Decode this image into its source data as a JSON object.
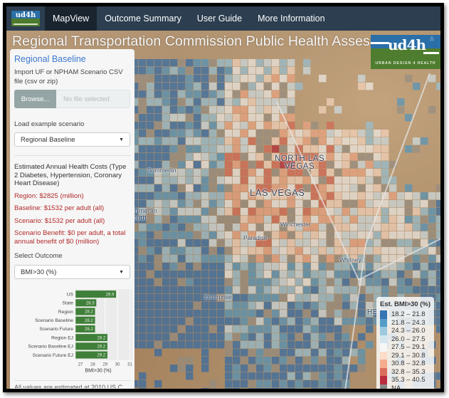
{
  "navbar": {
    "brand_logo": "ud4h",
    "items": [
      {
        "label": "MapView",
        "active": true
      },
      {
        "label": "Outcome Summary",
        "active": false
      },
      {
        "label": "User Guide",
        "active": false
      },
      {
        "label": "More Information",
        "active": false
      }
    ]
  },
  "map": {
    "title": "Regional Transportation Commission Public Health Assessment M",
    "logo": {
      "mark": "ud4h",
      "tagline": "URBAN DESIGN 4 HEALTH"
    },
    "collapse_icon": "chevron-double-down-icon",
    "places": [
      {
        "label": "NORTH LAS",
        "label2": "VEGAS"
      },
      {
        "label": "LAS VEGAS"
      },
      {
        "label": "Summerlin"
      },
      {
        "label": "mmerlin",
        "label2": "outh"
      },
      {
        "label": "Winchester"
      },
      {
        "label": "Paradise"
      },
      {
        "label": "Whitney"
      },
      {
        "label": "Enterprise"
      },
      {
        "label": "HEN"
      }
    ],
    "legend": {
      "title": "Est. BMI>30 (%)",
      "items": [
        {
          "label": "18.2 – 21.8",
          "color": "#2166ac"
        },
        {
          "label": "21.8 – 24.3",
          "color": "#4393c3"
        },
        {
          "label": "24.3 – 26.0",
          "color": "#92c5de"
        },
        {
          "label": "26.0 – 27.5",
          "color": "#d1e5f0"
        },
        {
          "label": "27.5 – 29.1",
          "color": "#f7f7f7"
        },
        {
          "label": "29.1 – 30.8",
          "color": "#fddbc7"
        },
        {
          "label": "30.8 – 32.8",
          "color": "#f4a582"
        },
        {
          "label": "32.8 – 35.3",
          "color": "#d6604d"
        },
        {
          "label": "35.3 – 40.5",
          "color": "#b2182b"
        },
        {
          "label": "NA",
          "color": "#808080"
        }
      ]
    }
  },
  "sidebar": {
    "title": "Regional Baseline",
    "import_label": "Import UF or NPHAM Scenario CSV file (csv or zip)",
    "browse_label": "Browse...",
    "file_placeholder": "No file selected",
    "example_label": "Load example scenario",
    "example_value": "Regional Baseline",
    "costs_title": "Estimated Annual Health Costs (Type 2 Diabetes, Hypertension, Coronary Heart Disease)",
    "region_cost": "Region: $2825 (million)",
    "baseline_cost": "Baseline: $1532 per adult (all)",
    "scenario_cost": "Scenario: $1532 per adult (all)",
    "scenario_benefit": "Scenario Benefit: $0 per adult, a total annual benefit of $0 (million)",
    "outcome_label": "Select Outcome",
    "outcome_value": "BMI>30 (%)",
    "footer_partial": "All values are estimated at 2010 US C..."
  },
  "chart_data": {
    "type": "bar",
    "orientation": "horizontal",
    "categories": [
      "US",
      "State",
      "Region",
      "Scenario Baseline",
      "Scenario Future",
      "Region EJ",
      "Scenario Baseline EJ",
      "Scenario Future EJ"
    ],
    "values": [
      29.9,
      28.3,
      28.2,
      28.2,
      28.2,
      29.2,
      29.2,
      29.2
    ],
    "data_labels": [
      "29.9",
      "28.3",
      "28.2",
      "28.2",
      "28.2",
      "29.2",
      "29.2",
      "29.2"
    ],
    "xlabel": "BMI>30 (%)",
    "ylabel": "",
    "xlim": [
      26.6,
      31.2
    ],
    "xticks": [
      27,
      28,
      29,
      30,
      31
    ],
    "bar_color": "#3f7f3a",
    "grid": true
  }
}
